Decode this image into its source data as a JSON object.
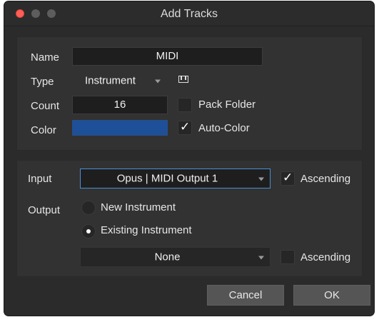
{
  "window": {
    "title": "Add Tracks"
  },
  "track": {
    "name_label": "Name",
    "name_value": "MIDI",
    "type_label": "Type",
    "type_value": "Instrument",
    "count_label": "Count",
    "count_value": "16",
    "pack_folder_label": "Pack Folder",
    "pack_folder_checked": false,
    "color_label": "Color",
    "color_value": "#1e4f99",
    "auto_color_label": "Auto-Color",
    "auto_color_checked": true
  },
  "routing": {
    "input_label": "Input",
    "input_value": "Opus | MIDI Output 1",
    "input_ascending_label": "Ascending",
    "input_ascending_checked": true,
    "output_label": "Output",
    "output_options": [
      "New Instrument",
      "Existing Instrument"
    ],
    "output_selected": "Existing Instrument",
    "instrument_value": "None",
    "instrument_ascending_label": "Ascending",
    "instrument_ascending_checked": false
  },
  "buttons": {
    "cancel": "Cancel",
    "ok": "OK"
  },
  "colors": {
    "accent": "#4a8fd4",
    "close": "#ff5f57"
  }
}
